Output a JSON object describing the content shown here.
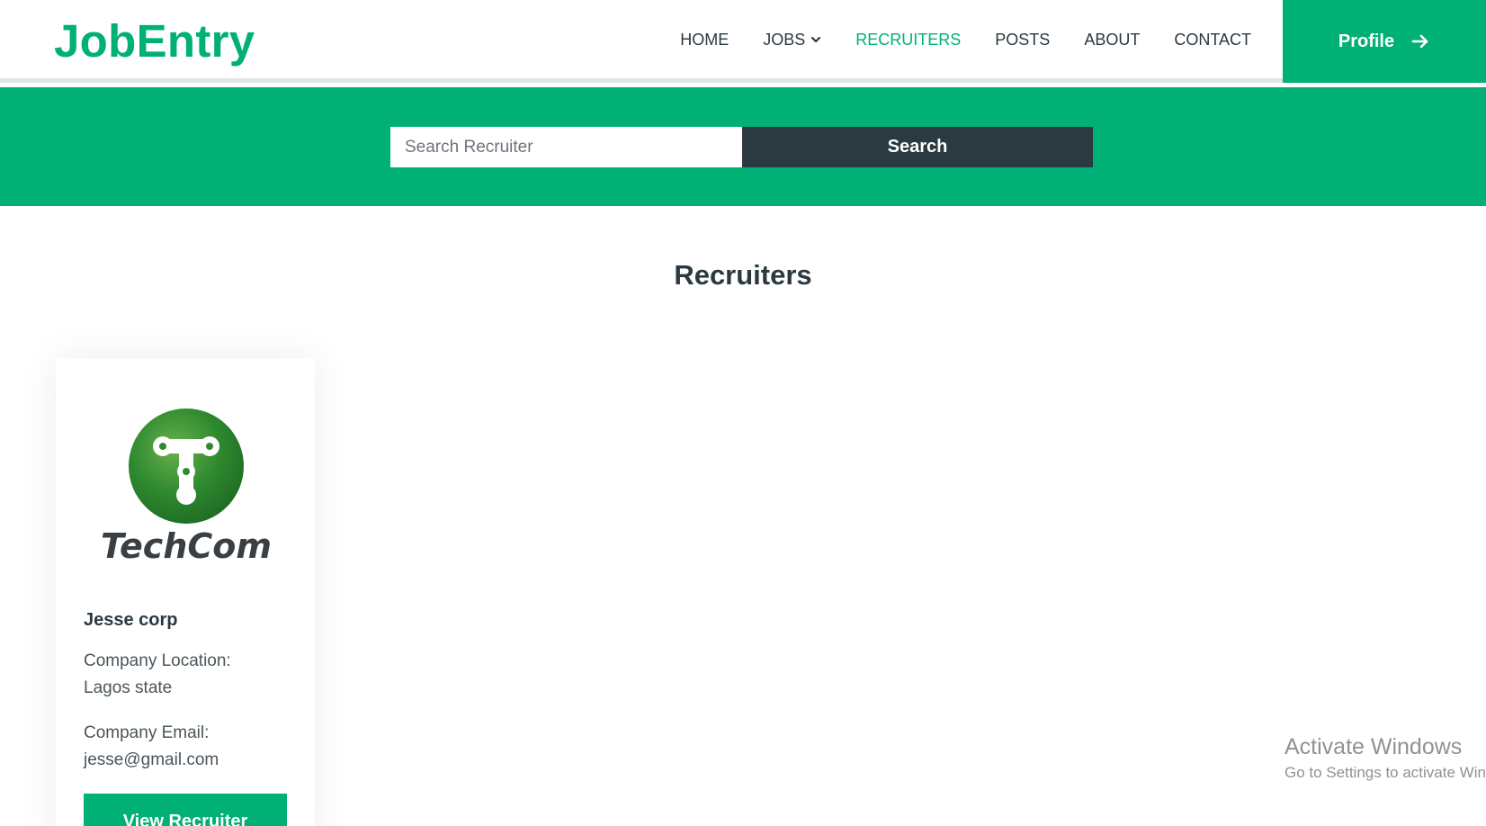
{
  "brand": {
    "name": "JobEntry",
    "color": "#00b074"
  },
  "nav": {
    "items": [
      {
        "label": "HOME",
        "active": false
      },
      {
        "label": "JOBS",
        "active": false,
        "has_dropdown": true,
        "icon": "chevron-down-icon"
      },
      {
        "label": "RECRUITERS",
        "active": true
      },
      {
        "label": "POSTS",
        "active": false
      },
      {
        "label": "ABOUT",
        "active": false
      },
      {
        "label": "CONTACT",
        "active": false
      }
    ],
    "profile_button": {
      "label": "Profile",
      "icon": "arrow-right-icon"
    }
  },
  "search": {
    "placeholder": "Search Recruiter",
    "value": "",
    "button_label": "Search"
  },
  "main": {
    "title": "Recruiters",
    "cards": [
      {
        "logo_text": "TechCom",
        "logo_icon": "techcom-logo-icon",
        "name": "Jesse corp",
        "location_label": "Company Location:",
        "location": "Lagos state",
        "email_label": "Company Email:",
        "email": "jesse@gmail.com",
        "button_label": "View Recruiter"
      }
    ]
  },
  "watermark": {
    "title": "Activate Windows",
    "subtitle": "Go to Settings to activate Windows."
  },
  "colors": {
    "accent": "#00b074",
    "dark": "#2b3940",
    "text": "#4b555b"
  }
}
